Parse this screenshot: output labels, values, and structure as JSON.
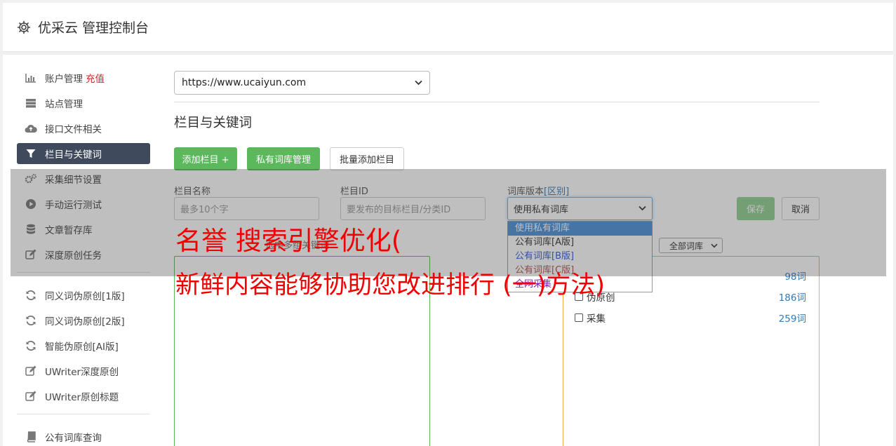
{
  "header": {
    "title": "优采云 管理控制台"
  },
  "sidebar": {
    "items": [
      {
        "label": "账户管理",
        "badge": "充值",
        "icon": "bar-chart-icon"
      },
      {
        "label": "站点管理",
        "icon": "server-icon"
      },
      {
        "label": "接口文件相关",
        "icon": "cloud-upload-icon"
      },
      {
        "label": "栏目与关键词",
        "icon": "filter-icon"
      },
      {
        "label": "采集细节设置",
        "icon": "cogs-icon"
      },
      {
        "label": "手动运行测试",
        "icon": "play-circle-icon"
      },
      {
        "label": "文章暂存库",
        "icon": "database-icon"
      },
      {
        "label": "深度原创任务",
        "icon": "edit-icon"
      }
    ],
    "items2": [
      {
        "label": "同义词伪原创[1版]",
        "icon": "refresh-icon"
      },
      {
        "label": "同义词伪原创[2版]",
        "icon": "refresh-icon"
      },
      {
        "label": "智能伪原创[AI版]",
        "icon": "refresh-icon"
      },
      {
        "label": "UWriter深度原创",
        "icon": "edit-icon"
      },
      {
        "label": "UWriter原创标题",
        "icon": "edit-icon"
      }
    ],
    "items3": [
      {
        "label": "公有词库查询",
        "icon": "book-icon"
      }
    ]
  },
  "main": {
    "site_select": "https://www.ucaiyun.com",
    "section_title": "栏目与关键词",
    "buttons": {
      "add_column": "添加栏目 +",
      "private_lib": "私有词库管理",
      "batch_add": "批量添加栏目"
    },
    "form": {
      "name_label": "栏目名称",
      "name_placeholder": "最多10个字",
      "id_label": "栏目ID",
      "id_placeholder": "要发布的目标栏目/分类ID",
      "version_label": "词库版本",
      "version_link": "[区别]",
      "version_value": "使用私有词库",
      "version_options": [
        "使用私有词库",
        "公有词库[A版]",
        "公有词库[B版]",
        "公有词库[C版]",
        "全网采集"
      ],
      "save": "保存",
      "cancel": "取消"
    },
    "sub_label": "选中多组关键词",
    "lib_filter": "全部词库",
    "libs": [
      {
        "name": "",
        "count": "98词"
      },
      {
        "name": "伪原创",
        "count": "186词"
      },
      {
        "name": "采集",
        "count": "259词"
      }
    ]
  },
  "overlay_text": {
    "line1": "名誉 搜索引擎优化(",
    "line2": "新鲜内容能够协助您改进排行 (一)方法)"
  },
  "colors": {
    "active_nav": "#3f4a5c",
    "green": "#5cb85c",
    "orange": "#f0ad4e",
    "red": "#f20000"
  }
}
